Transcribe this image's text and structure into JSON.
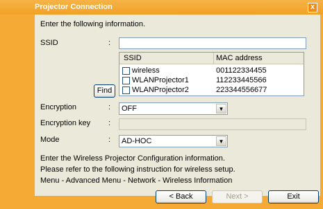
{
  "window": {
    "title": "Projector Connection",
    "close_glyph": "x"
  },
  "intro": "Enter the following information.",
  "ssid": {
    "label": "SSID",
    "colon": ":",
    "value": ""
  },
  "network_list": {
    "headers": [
      "SSID",
      "MAC address"
    ],
    "rows": [
      {
        "name": "wireless",
        "mac": "001122334455",
        "checked": false
      },
      {
        "name": "WLANProjector1",
        "mac": "112233445566",
        "checked": false
      },
      {
        "name": "WLANProjector2",
        "mac": "223344556677",
        "checked": false
      }
    ]
  },
  "find_button": "Find",
  "encryption": {
    "label": "Encryption",
    "colon": ":",
    "selected": "OFF"
  },
  "encryption_key": {
    "label": "Encryption key",
    "colon": ":",
    "value": ""
  },
  "mode": {
    "label": "Mode",
    "colon": ":",
    "selected": "AD-HOC"
  },
  "info_lines": [
    "Enter the Wireless Projector Configuration information.",
    "Please refer to the following instruction for wireless setup.",
    "Menu - Advanced Menu - Network - Wireless Information"
  ],
  "buttons": {
    "back": "< Back",
    "next": "Next >",
    "exit": "Exit"
  },
  "icons": {
    "dropdown": "chevron-down-icon",
    "close": "close-icon",
    "checkbox": "checkbox-icon"
  },
  "colors": {
    "accent": "#f4aa35",
    "panel": "#ebe9d9",
    "border": "#7f9db9"
  }
}
